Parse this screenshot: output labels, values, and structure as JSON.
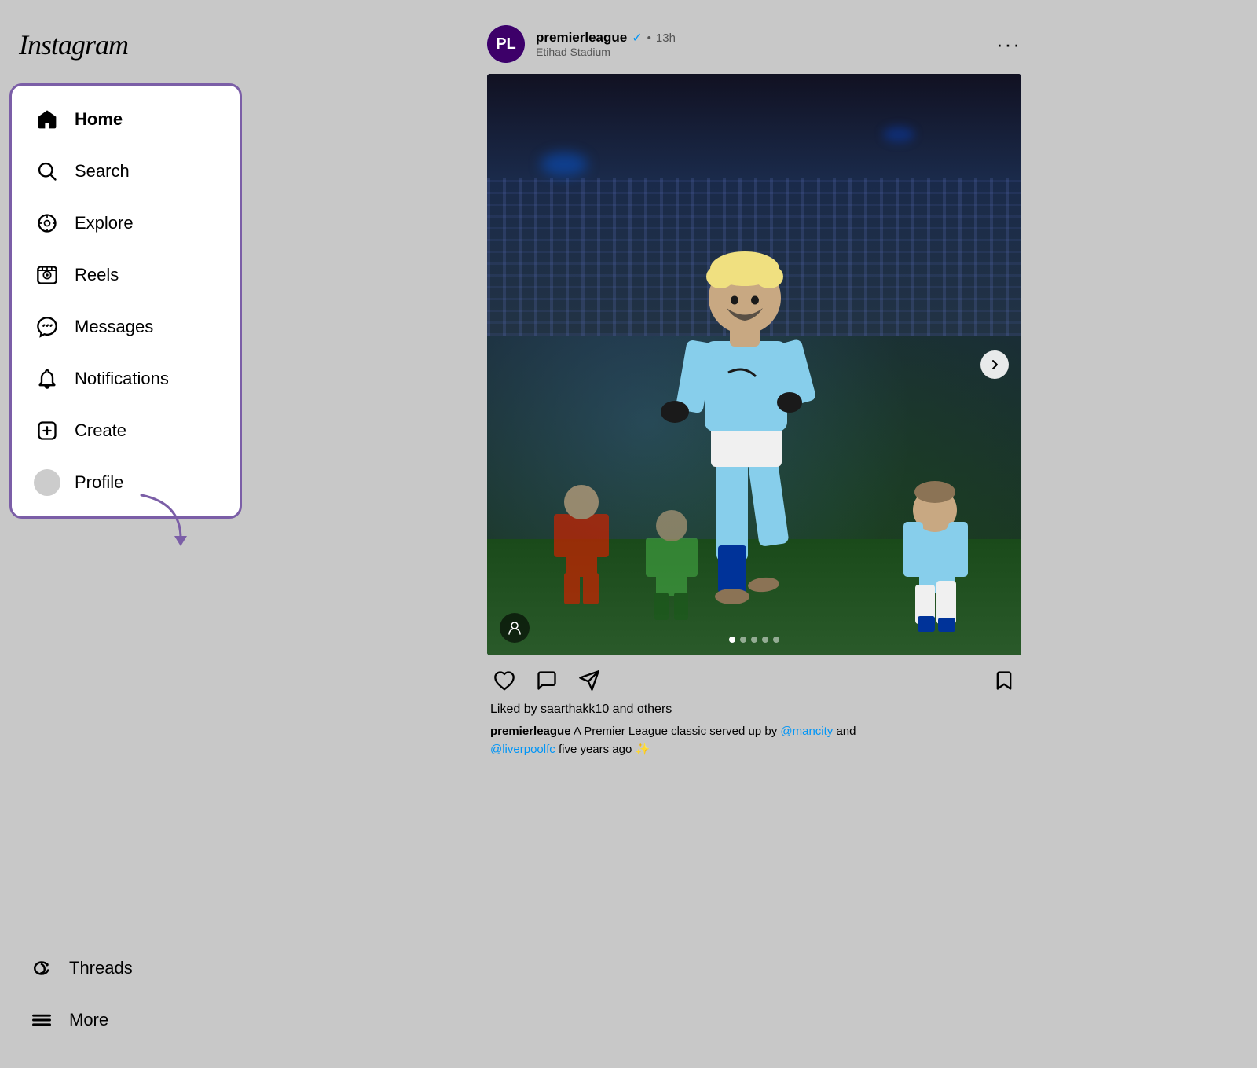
{
  "app": {
    "logo": "Instagram"
  },
  "sidebar": {
    "nav_items": [
      {
        "id": "home",
        "label": "Home",
        "active": true
      },
      {
        "id": "search",
        "label": "Search",
        "active": false
      },
      {
        "id": "explore",
        "label": "Explore",
        "active": false
      },
      {
        "id": "reels",
        "label": "Reels",
        "active": false
      },
      {
        "id": "messages",
        "label": "Messages",
        "active": false
      },
      {
        "id": "notifications",
        "label": "Notifications",
        "active": false
      },
      {
        "id": "create",
        "label": "Create",
        "active": false
      },
      {
        "id": "profile",
        "label": "Profile",
        "active": false
      }
    ],
    "bottom_items": [
      {
        "id": "threads",
        "label": "Threads"
      },
      {
        "id": "more",
        "label": "More"
      }
    ]
  },
  "post": {
    "author": {
      "username": "premierleague",
      "verified": true,
      "location": "Etihad Stadium",
      "time": "13h"
    },
    "carousel_dots": [
      {
        "active": true
      },
      {
        "active": false
      },
      {
        "active": false
      },
      {
        "active": false
      },
      {
        "active": false
      }
    ],
    "likes_text": "Liked by",
    "likes_user": "saarthakk10",
    "likes_others": "and others",
    "caption_user": "premierleague",
    "caption_text": "A Premier League classic served up by",
    "caption_mention1": "@mancity",
    "caption_and": "and",
    "caption_mention2": "@liverpoolfc",
    "caption_end": "five years ago ✨"
  },
  "colors": {
    "accent_purple": "#7B5EA7",
    "verified_blue": "#0095f6"
  }
}
